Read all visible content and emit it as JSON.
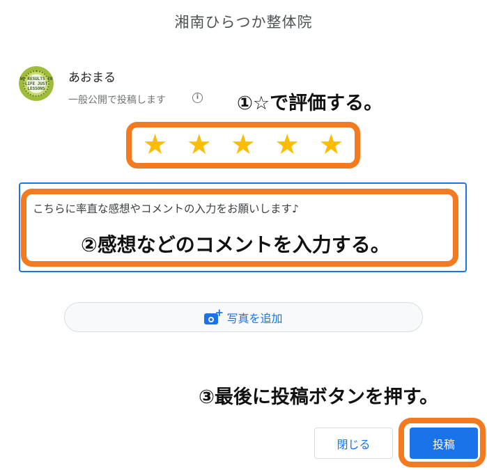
{
  "dialog": {
    "title": "湘南ひらつか整体院"
  },
  "user": {
    "name": "あおまる",
    "visibility_note": "一般公開で投稿します",
    "info_icon": "info-icon",
    "avatar_text": "NO RESULTS IN LIFE JUST LESSONS"
  },
  "rating": {
    "stars": [
      "★",
      "★",
      "★",
      "★",
      "★"
    ],
    "star_color": "#fbbc04"
  },
  "comment": {
    "placeholder": "こちらに率直な感想やコメントの入力をお願いします♪"
  },
  "add_photo": {
    "label": "写真を追加",
    "icon": "add-photo-icon"
  },
  "buttons": {
    "close_label": "閉じる",
    "post_label": "投稿"
  },
  "annotations": {
    "step1": "①☆で評価する。",
    "step2": "②感想などのコメントを入力する。",
    "step3": "③最後に投稿ボタンを押す。"
  },
  "colors": {
    "accent": "#1a73e8",
    "highlight": "#f47a1f"
  }
}
